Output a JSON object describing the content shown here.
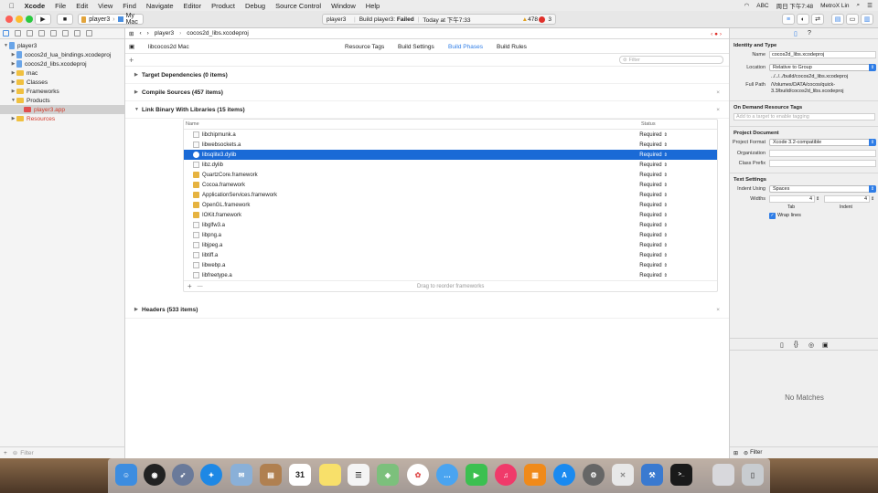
{
  "menubar": {
    "apple": "",
    "items": [
      "Xcode",
      "File",
      "Edit",
      "View",
      "Find",
      "Navigate",
      "Editor",
      "Product",
      "Debug",
      "Source Control",
      "Window",
      "Help"
    ],
    "status_abc": "ABC",
    "clock": "周日 下午7:48",
    "user": "MetroX Lin"
  },
  "toolbar": {
    "scheme": "player3",
    "destination": "My Mac",
    "activity_project": "player3",
    "activity_prefix": "Build player3:",
    "activity_status": "Failed",
    "activity_time": "Today at 下午7:33",
    "warnings": "478",
    "errors": "3"
  },
  "navigator": {
    "items": [
      {
        "label": "player3",
        "indent": 0,
        "disc": "▼",
        "icon": "doc"
      },
      {
        "label": "cocos2d_lua_bindings.xcodeproj",
        "indent": 1,
        "disc": "▶",
        "icon": "doc"
      },
      {
        "label": "cocos2d_libs.xcodeproj",
        "indent": 1,
        "disc": "▶",
        "icon": "doc"
      },
      {
        "label": "mac",
        "indent": 1,
        "disc": "▶",
        "icon": "folder"
      },
      {
        "label": "Classes",
        "indent": 1,
        "disc": "▶",
        "icon": "folder"
      },
      {
        "label": "Frameworks",
        "indent": 1,
        "disc": "▶",
        "icon": "folder"
      },
      {
        "label": "Products",
        "indent": 1,
        "disc": "▼",
        "icon": "folder"
      },
      {
        "label": "player3.app",
        "indent": 2,
        "disc": "",
        "icon": "app",
        "red": true,
        "selected": true
      },
      {
        "label": "Resources",
        "indent": 1,
        "disc": "▶",
        "icon": "folder",
        "red": true
      }
    ],
    "filter_placeholder": "Filter"
  },
  "editor": {
    "jump_project": "player3",
    "jump_file": "cocos2d_libs.xcodeproj",
    "target_popup": "libcocos2d Mac",
    "tabs": [
      "Resource Tags",
      "Build Settings",
      "Build Phases",
      "Build Rules"
    ],
    "active_tab": "Build Phases",
    "filter_placeholder": "Filter",
    "phases": {
      "target_deps": "Target Dependencies (0 items)",
      "compile_sources": "Compile Sources (457 items)",
      "link_binary": "Link Binary With Libraries (15 items)",
      "headers": "Headers (533 items)"
    },
    "lib_table": {
      "col_name": "Name",
      "col_status": "Status",
      "rows": [
        {
          "name": "libchipmunk.a",
          "status": "Required",
          "icon": "l"
        },
        {
          "name": "libwebsockets.a",
          "status": "Required",
          "icon": "l"
        },
        {
          "name": "libsqlite3.dylib",
          "status": "Required",
          "icon": "d",
          "selected": true
        },
        {
          "name": "libz.dylib",
          "status": "Required",
          "icon": "l"
        },
        {
          "name": "QuartzCore.framework",
          "status": "Required",
          "icon": "f"
        },
        {
          "name": "Cocoa.framework",
          "status": "Required",
          "icon": "f"
        },
        {
          "name": "ApplicationServices.framework",
          "status": "Required",
          "icon": "f"
        },
        {
          "name": "OpenGL.framework",
          "status": "Required",
          "icon": "f"
        },
        {
          "name": "IOKit.framework",
          "status": "Required",
          "icon": "f"
        },
        {
          "name": "libglfw3.a",
          "status": "Required",
          "icon": "l"
        },
        {
          "name": "libpng.a",
          "status": "Required",
          "icon": "l"
        },
        {
          "name": "libjpeg.a",
          "status": "Required",
          "icon": "l"
        },
        {
          "name": "libtiff.a",
          "status": "Required",
          "icon": "l"
        },
        {
          "name": "libwebp.a",
          "status": "Required",
          "icon": "l"
        },
        {
          "name": "libfreetype.a",
          "status": "Required",
          "icon": "l"
        }
      ],
      "add": "+",
      "remove": "—",
      "footer_hint": "Drag to reorder frameworks"
    }
  },
  "inspector": {
    "identity_title": "Identity and Type",
    "name_label": "Name",
    "name_value": "cocos2d_libs.xcodeproj",
    "location_label": "Location",
    "location_value": "Relative to Group",
    "location_path": "../../../build/cocos2d_libs.xcodeproj",
    "fullpath_label": "Full Path",
    "fullpath_value": "/Volumes/DATA/cocos/quick-3.3/build/cocos2d_libs.xcodeproj",
    "odr_title": "On Demand Resource Tags",
    "odr_placeholder": "Add to a target to enable tagging",
    "project_doc_title": "Project Document",
    "project_format_label": "Project Format",
    "project_format_value": "Xcode 3.2-compatible",
    "organization_label": "Organization",
    "class_prefix_label": "Class Prefix",
    "text_settings_title": "Text Settings",
    "indent_using_label": "Indent Using",
    "indent_using_value": "Spaces",
    "widths_label": "Widths",
    "tab_value": "4",
    "indent_value": "4",
    "tab_label": "Tab",
    "indent_label": "Indent",
    "wrap_lines": "Wrap lines",
    "no_matches": "No Matches",
    "filter_placeholder": "Filter"
  },
  "dock": {
    "calendar_day": "31"
  }
}
